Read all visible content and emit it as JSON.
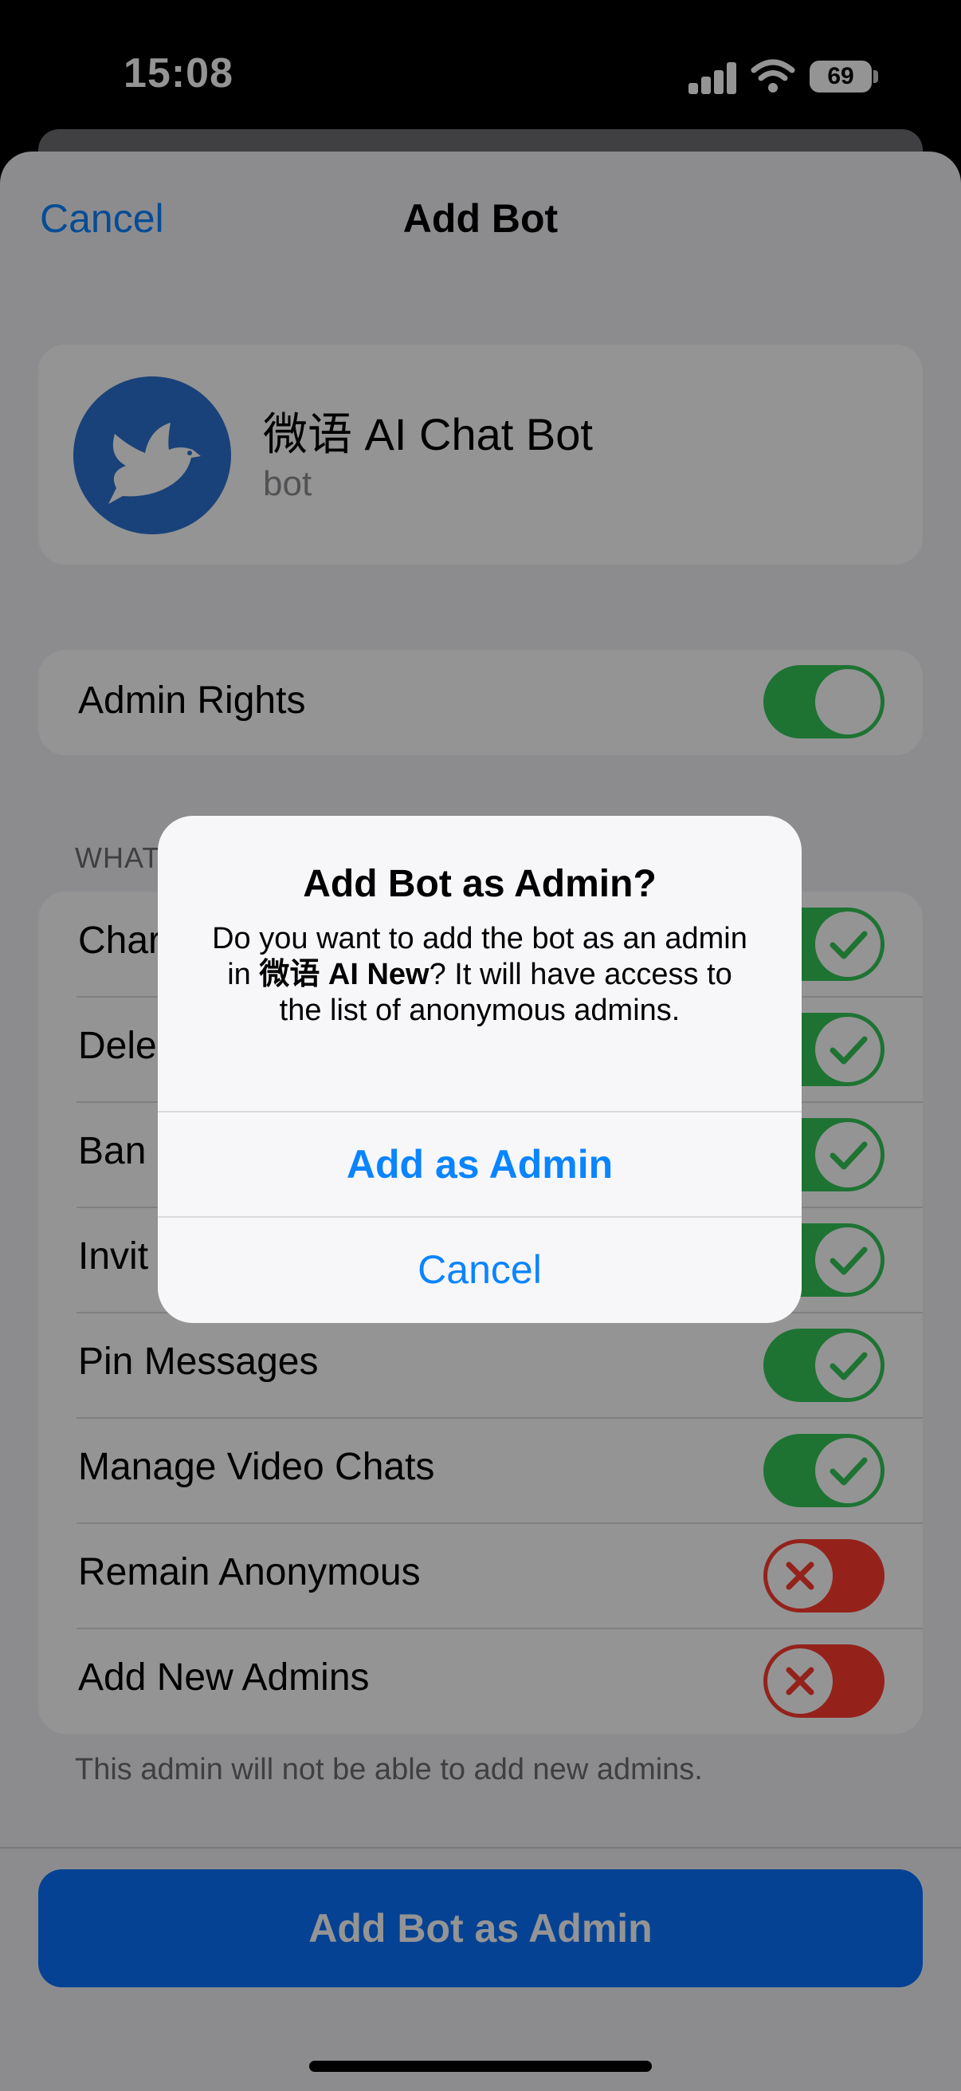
{
  "status_bar": {
    "time": "15:08",
    "battery": "69"
  },
  "nav": {
    "cancel": "Cancel",
    "title": "Add Bot"
  },
  "bot": {
    "name": "微语 AI Chat Bot",
    "subtitle": "bot"
  },
  "admin_rights": {
    "label": "Admin Rights",
    "enabled": true
  },
  "section_header": "WHAT",
  "permissions": [
    {
      "label": "Char",
      "enabled": true
    },
    {
      "label": "Dele",
      "enabled": true
    },
    {
      "label": "Ban",
      "enabled": true
    },
    {
      "label": "Invit",
      "enabled": true
    },
    {
      "label": "Pin Messages",
      "enabled": true
    },
    {
      "label": "Manage Video Chats",
      "enabled": true
    },
    {
      "label": "Remain Anonymous",
      "enabled": false
    },
    {
      "label": "Add New Admins",
      "enabled": false
    }
  ],
  "footer_note": "This admin will not be able to add new admins.",
  "primary_button": "Add Bot as Admin",
  "dialog": {
    "title": "Add Bot as Admin?",
    "message_before": "Do you want to add the bot as an admin in ",
    "group_name": "微语 AI New",
    "message_after": "? It will have access to the list of anonymous admins.",
    "confirm": "Add as Admin",
    "cancel": "Cancel"
  },
  "colors": {
    "accent": "#0a84ff",
    "toggle_on": "#34c759",
    "toggle_off": "#ff3b30",
    "avatar": "#2c73d2"
  }
}
